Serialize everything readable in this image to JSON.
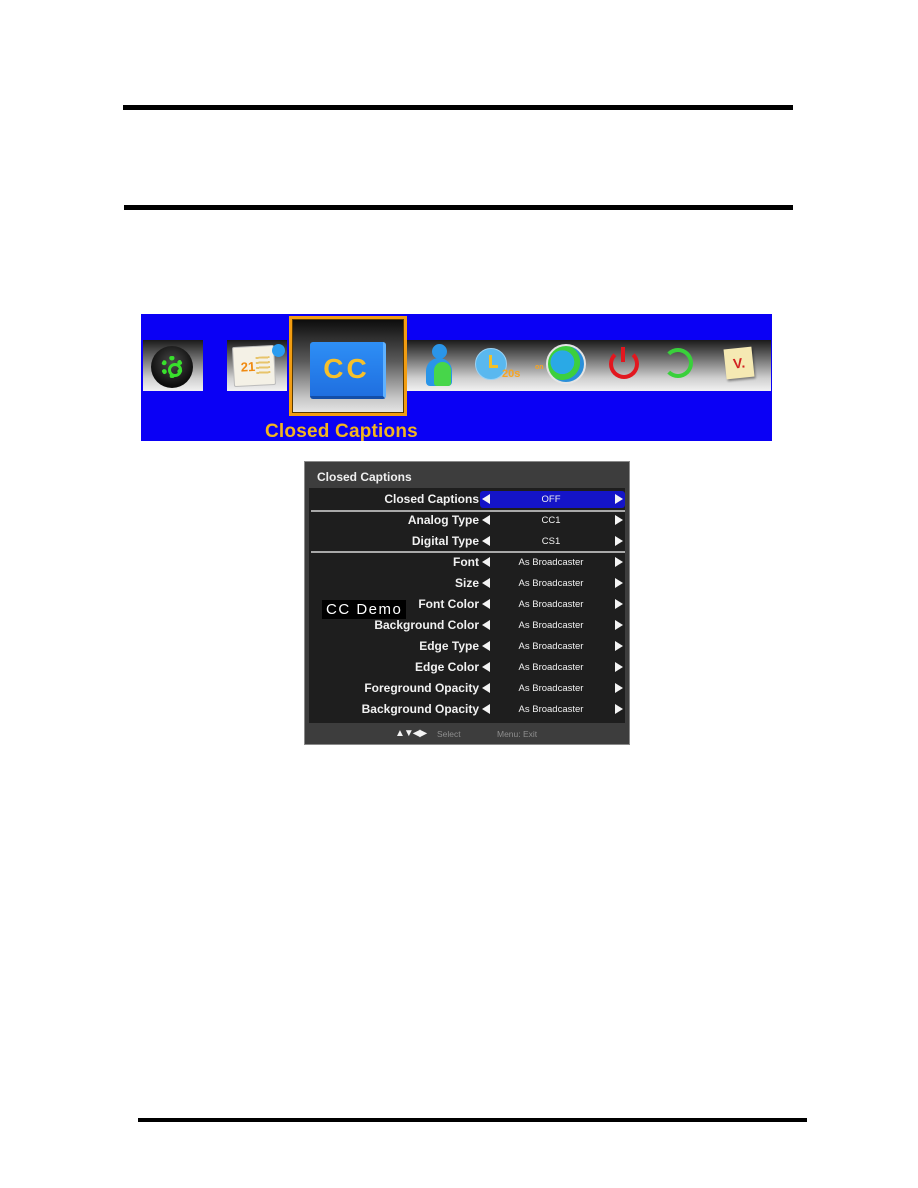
{
  "menu_bar": {
    "selected_label": "Closed Captions",
    "cc_icon_text": "CC",
    "calendar_day": "21",
    "timer_text": "20s",
    "timer_sub": "on",
    "version_text": "V.",
    "icons": [
      "gear-icon",
      "calendar-icon",
      "cc-icon",
      "user-icon",
      "timer-icon",
      "globe-icon",
      "power-icon",
      "refresh-icon",
      "version-icon"
    ],
    "colors": {
      "background": "#0a00f5",
      "selected_border": "#f29d12",
      "label": "#f2b51e"
    }
  },
  "osd": {
    "title": "Closed Captions",
    "demo_text": "CC Demo",
    "rows": [
      {
        "label": "Closed Captions",
        "value": "OFF",
        "active": true
      },
      {
        "label": "Analog Type",
        "value": "CC1"
      },
      {
        "label": "Digital Type",
        "value": "CS1"
      },
      {
        "label": "Font",
        "value": "As Broadcaster"
      },
      {
        "label": "Size",
        "value": "As Broadcaster"
      },
      {
        "label": "Font Color",
        "value": "As Broadcaster"
      },
      {
        "label": "Background Color",
        "value": "As Broadcaster"
      },
      {
        "label": "Edge Type",
        "value": "As Broadcaster"
      },
      {
        "label": "Edge Color",
        "value": "As Broadcaster"
      },
      {
        "label": "Foreground Opacity",
        "value": "As Broadcaster"
      },
      {
        "label": "Background Opacity",
        "value": "As Broadcaster"
      }
    ],
    "footer": {
      "keys": "▲▼◀▶",
      "select": "Select",
      "menu_exit": "Menu: Exit"
    },
    "colors": {
      "highlight": "#1414c8",
      "panel": "#3d3d3d"
    }
  }
}
